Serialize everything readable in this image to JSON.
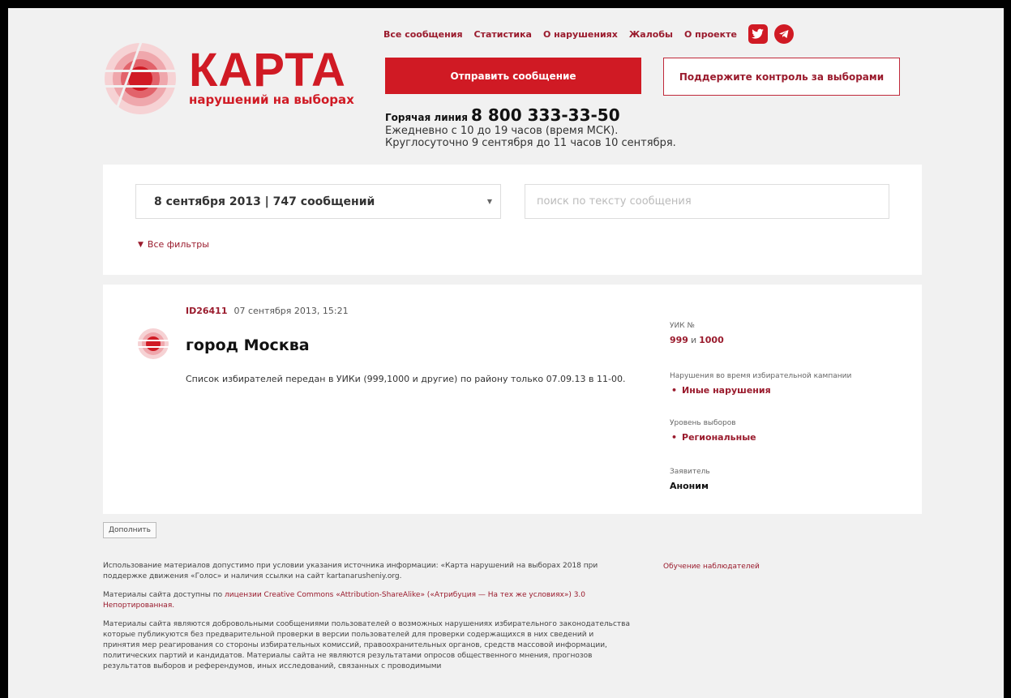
{
  "header": {
    "logo_title": "КАРТА",
    "logo_subtitle": "нарушений на выборах",
    "nav": [
      "Все сообщения",
      "Статистика",
      "О нарушениях",
      "Жалобы",
      "О проекте"
    ],
    "social_icons": [
      "twitter-icon",
      "telegram-icon"
    ],
    "send_button": "Отправить сообщение",
    "support_button": "Поддержите контроль за выборами",
    "hotline_label": "Горячая линия",
    "hotline_phone": "8 800 333-33-50",
    "hotline_note_1": "Ежедневно с 10 до 19 часов (время МСК).",
    "hotline_note_2": "Круглосуточно 9 сентября до 11 часов 10 сентября."
  },
  "filters": {
    "selected_date": "8 сентября 2013 | 747 сообщений",
    "search_placeholder": "поиск по тексту сообщения",
    "all_filters": "Все фильтры"
  },
  "message": {
    "id": "ID26411",
    "date": "07 сентября 2013, 15:21",
    "city": "город Москва",
    "text": "Список избирателей передан в УИКи (999,1000 и другие) по району только 07.09.13 в 11-00.",
    "uik_label": "УИК №",
    "uik_1": "999",
    "uik_and": "и",
    "uik_2": "1000",
    "violation_label": "Нарушения во время избирательной кампании",
    "violation_value": "Иные нарушения",
    "level_label": "Уровень выборов",
    "level_value": "Региональные",
    "applicant_label": "Заявитель",
    "applicant_value": "Аноним"
  },
  "add_button": "Дополнить",
  "footer": {
    "p1": "Использование материалов допустимо при условии указания источника информации: «Карта нарушений на выборах 2018 при поддержке движения «Голос» и наличия ссылки на сайт kartanarusheniy.org.",
    "p2_prefix": "Материалы сайта доступны по",
    "p2_link": "лицензии Creative Commons «Attribution-ShareAlike» («Атрибуция — На тех же условиях») 3.0 Непортированная.",
    "p3": "Материалы сайта являются добровольными сообщениями пользователей о возможных нарушениях избирательного законодательства которые публикуются без предварительной проверки в версии пользователей для проверки содержащихся в них сведений и принятия мер реагирования со стороны избирательных комиссий, правоохранительных органов, средств массовой информации, политических партий и кандидатов. Материалы сайта не являются результатами опросов общественного мнения, прогнозов результатов выборов и референдумов, иных исследований, связанных с проводимыми",
    "right_link": "Обучение наблюдателей"
  },
  "colors": {
    "accent": "#d01a24",
    "link": "#9a1b2d"
  }
}
